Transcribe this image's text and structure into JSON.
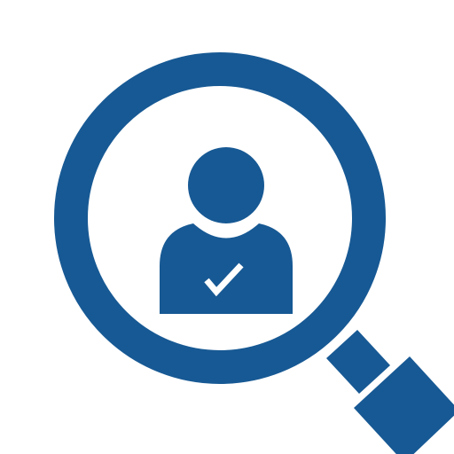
{
  "icon": {
    "name": "user-search-icon",
    "parts": [
      "magnifying-glass-icon",
      "person-icon",
      "checkmark-icon"
    ]
  },
  "colors": {
    "background": "#ffffff",
    "primary": "#175994",
    "inner": "#ffffff"
  }
}
